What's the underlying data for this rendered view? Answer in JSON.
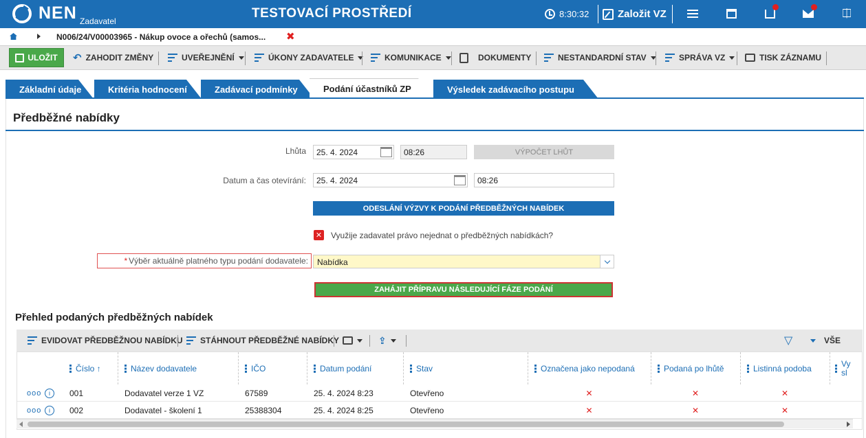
{
  "header": {
    "logo": "NEN",
    "logo_sub": "Zadavatel",
    "env_title": "TESTOVACÍ PROSTŘEDÍ",
    "clock": "8:30:32",
    "create_vz": "Založit VZ"
  },
  "breadcrumb": {
    "text": "N006/24/V00003965 - Nákup ovoce a ořechů (samos...",
    "close": "✖"
  },
  "toolbar": {
    "save": "ULOŽIT",
    "discard": "ZAHODIT ZMĚNY",
    "publish": "UVEŘEJNĚNÍ",
    "actions": "ÚKONY ZADAVATELE",
    "communication": "KOMUNIKACE",
    "documents": "DOKUMENTY",
    "nonstandard": "NESTANDARDNÍ STAV",
    "management": "SPRÁVA VZ",
    "print": "TISK ZÁZNAMU"
  },
  "tabs": [
    "Základní údaje",
    "Kritéria hodnocení",
    "Zadávací podmínky",
    "Podání účastníků ZP",
    "Výsledek zadávacího postupu"
  ],
  "section": {
    "title": "Předběžné nabídky",
    "deadline_label": "Lhůta",
    "deadline_date": "25. 4. 2024",
    "deadline_time": "08:26",
    "calc_button": "VÝPOČET LHŮT",
    "opening_label": "Datum a čas otevírání:",
    "opening_date": "25. 4. 2024",
    "opening_time": "08:26",
    "send_button": "ODESLÁNÍ VÝZVY K PODÁNÍ PŘEDBĚŽNÝCH NABÍDEK",
    "checkbox_label": "Využije zadavatel právo nejednat o předběžných nabídkách?",
    "select_label": "Výběr aktuálně platného typu podání dodavatele:",
    "select_required": "*",
    "select_value": "Nabídka",
    "start_button": "ZAHÁJIT PŘÍPRAVU NÁSLEDUJÍCÍ FÁZE PODÁNÍ"
  },
  "grid": {
    "title": "Přehled podaných předběžných nabídek",
    "toolbar": {
      "record": "EVIDOVAT PŘEDBĚŽNOU NABÍDKU",
      "download": "STÁHNOUT PŘEDBĚŽNÉ NABÍDKY",
      "all": "VŠE"
    },
    "columns": [
      "Číslo ↑",
      "Název dodavatele",
      "IČO",
      "Datum podání",
      "Stav",
      "Označena jako nepodaná",
      "Podaná po lhůtě",
      "Listinná podoba",
      "Vy sl"
    ],
    "rows": [
      {
        "num": "001",
        "name": "Dodavatel verze 1 VZ",
        "ico": "67589",
        "date": "25. 4. 2024 8:23",
        "state": "Otevřeno",
        "x1": "✕",
        "x2": "✕",
        "x3": "✕"
      },
      {
        "num": "002",
        "name": "Dodavatel - školení 1",
        "ico": "25388304",
        "date": "25. 4. 2024 8:25",
        "state": "Otevřeno",
        "x1": "✕",
        "x2": "✕",
        "x3": "✕"
      }
    ],
    "row_menu": "ooo",
    "row_info": "i"
  }
}
